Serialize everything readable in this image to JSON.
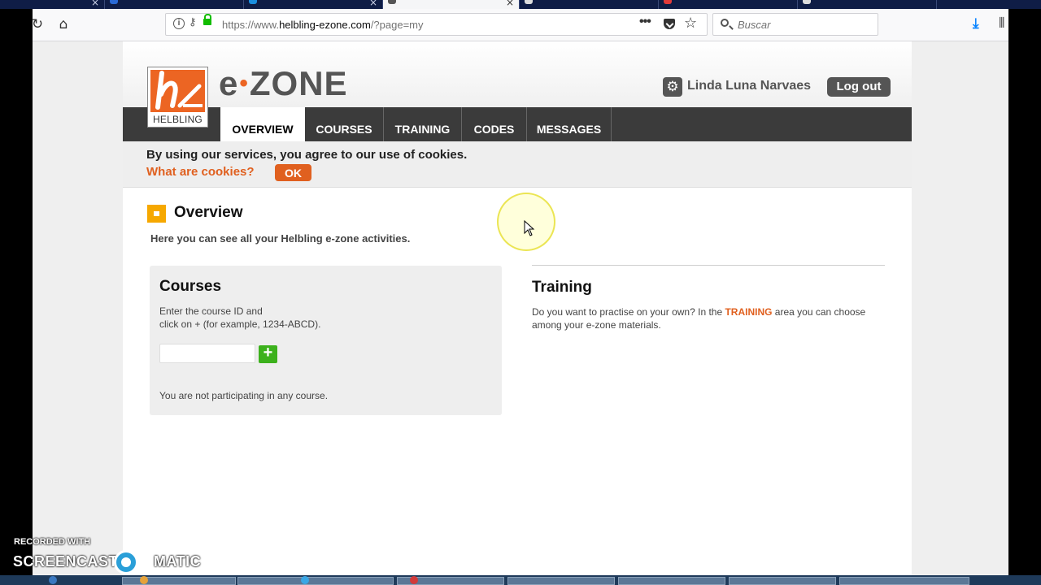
{
  "browser": {
    "url_prefix": "https://www.",
    "url_domain": "helbling-ezone.com",
    "url_path": "/?page=my",
    "search_placeholder": "Buscar"
  },
  "header": {
    "logo_text": "HELBLING",
    "brand_left": "e",
    "brand_dot": "•",
    "brand_right": "ZONE",
    "user_name": "Linda Luna Narvaes",
    "logout_label": "Log out"
  },
  "menu": [
    {
      "label": "OVERVIEW",
      "active": true
    },
    {
      "label": "COURSES"
    },
    {
      "label": "TRAINING"
    },
    {
      "label": "CODES"
    },
    {
      "label": "MESSAGES"
    }
  ],
  "cookie": {
    "message": "By using our services, you agree to our use of cookies.",
    "link": "What are cookies?",
    "ok_label": "OK"
  },
  "overview": {
    "title": "Overview",
    "description": "Here you can see all your Helbling e-zone activities."
  },
  "courses": {
    "title": "Courses",
    "hint_line1": "Enter the course ID and",
    "hint_line2": "click on + (for example, 1234-ABCD).",
    "input_value": "",
    "status": "You are not participating in any course."
  },
  "training": {
    "title": "Training",
    "text_before": "Do you want to practise on your own? In the ",
    "highlight": "TRAINING",
    "text_after": " area you can choose among your e-zone materials."
  },
  "watermark": {
    "line1": "RECORDED WITH",
    "left": "SCREENCAST",
    "right": "MATIC"
  },
  "colors": {
    "accent": "#ec6523",
    "menubar": "#3b3b3b",
    "overview_icon": "#f6a800",
    "add_button": "#3cb11c"
  }
}
